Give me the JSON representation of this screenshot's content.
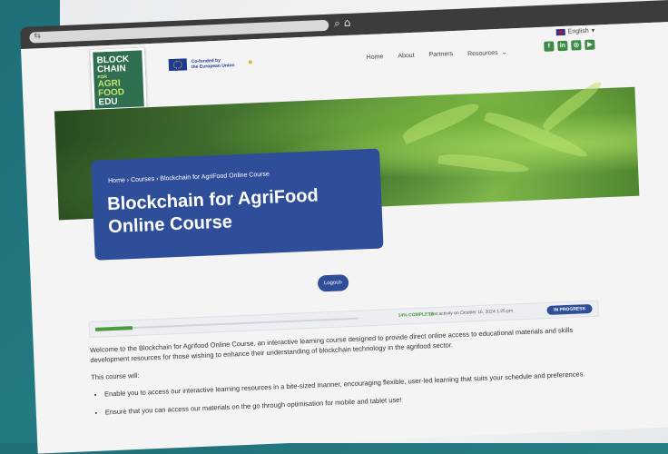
{
  "window": {
    "controls": [
      "_",
      "☐",
      "✕"
    ]
  },
  "browser": {
    "search_icon": "⌕",
    "home_icon": "⌂"
  },
  "site": {
    "logo": {
      "line1": "BLOCK",
      "line2": "CHAIN",
      "line3": "FOR",
      "line4": "AGRI",
      "line5": "FOOD",
      "line6": "EDU"
    },
    "eu": {
      "line1": "Co-funded by",
      "line2": "the European Union"
    },
    "nav": [
      "Home",
      "About",
      "Partners",
      "Resources"
    ],
    "language": "English",
    "social": [
      "f",
      "in",
      "◎",
      "▶"
    ]
  },
  "hero": {
    "breadcrumb": [
      "Home",
      "Courses",
      "Blockchain for AgriFood Online Course"
    ],
    "title": "Blockchain for AgriFood Online Course"
  },
  "logout_label": "Logout",
  "progress": {
    "percent": 14,
    "complete_label": "14% COMPLETE",
    "last_activity": "Last activity on October 16, 2024 1:25 pm",
    "status": "IN PROGRESS"
  },
  "content": {
    "intro": "Welcome to the Blockchain for Agrifood Online Course, an interactive learning course designed to provide direct online access to educational materials and skills development resources for those wishing to enhance their understanding of blockchain technology in the agrifood sector.",
    "course_will": "This course will:",
    "bullets": [
      "Enable you to access our interactive learning resources in a bite-sized manner, encouraging flexible, user-led learning that suits your schedule and preferences.",
      "Ensure that you can access our materials on the go through optimisation for mobile and tablet use!"
    ]
  }
}
